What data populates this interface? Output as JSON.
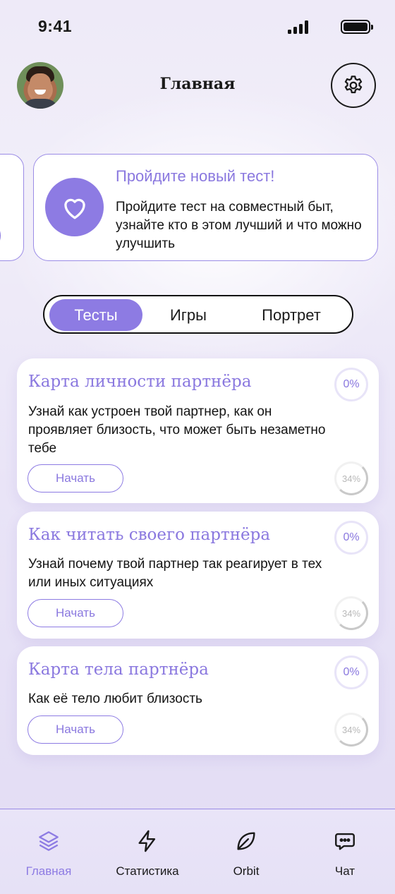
{
  "status_bar": {
    "time": "9:41"
  },
  "header": {
    "title": "Главная"
  },
  "promo": {
    "title": "Пройдите новый тест!",
    "text": "Пройдите тест на совместный быт, узнайте кто в этом лучший и что можно улучшить",
    "icon": "heart-icon"
  },
  "segments": {
    "items": [
      {
        "label": "Тесты"
      },
      {
        "label": "Игры"
      },
      {
        "label": "Портрет"
      }
    ],
    "active": "Тесты"
  },
  "tests": [
    {
      "title": "Карта личности партнёра",
      "text": "Узнай как устроен твой партнер, как он проявляет близость, что может быть незаметно тебе",
      "button": "Начать",
      "progress_label": "0%",
      "secondary_progress_label": "34%"
    },
    {
      "title": "Как читать своего партнёра",
      "text": "Узнай почему твой партнер так реагирует в тех или иных ситуациях",
      "button": "Начать",
      "progress_label": "0%",
      "secondary_progress_label": "34%"
    },
    {
      "title": "Карта тела партнёра",
      "text": "Как её тело любит близость",
      "button": "Начать",
      "progress_label": "0%",
      "secondary_progress_label": "34%"
    }
  ],
  "bottom_nav": {
    "items": [
      {
        "label": "Главная",
        "icon": "layers-icon"
      },
      {
        "label": "Статистика",
        "icon": "lightning-icon"
      },
      {
        "label": "Orbit",
        "icon": "leaf-icon"
      },
      {
        "label": "Чат",
        "icon": "chat-icon"
      }
    ],
    "active": "Главная"
  },
  "colors": {
    "accent": "#8d7be3",
    "accent_text": "#8a78df",
    "background": "#ece8f8"
  }
}
